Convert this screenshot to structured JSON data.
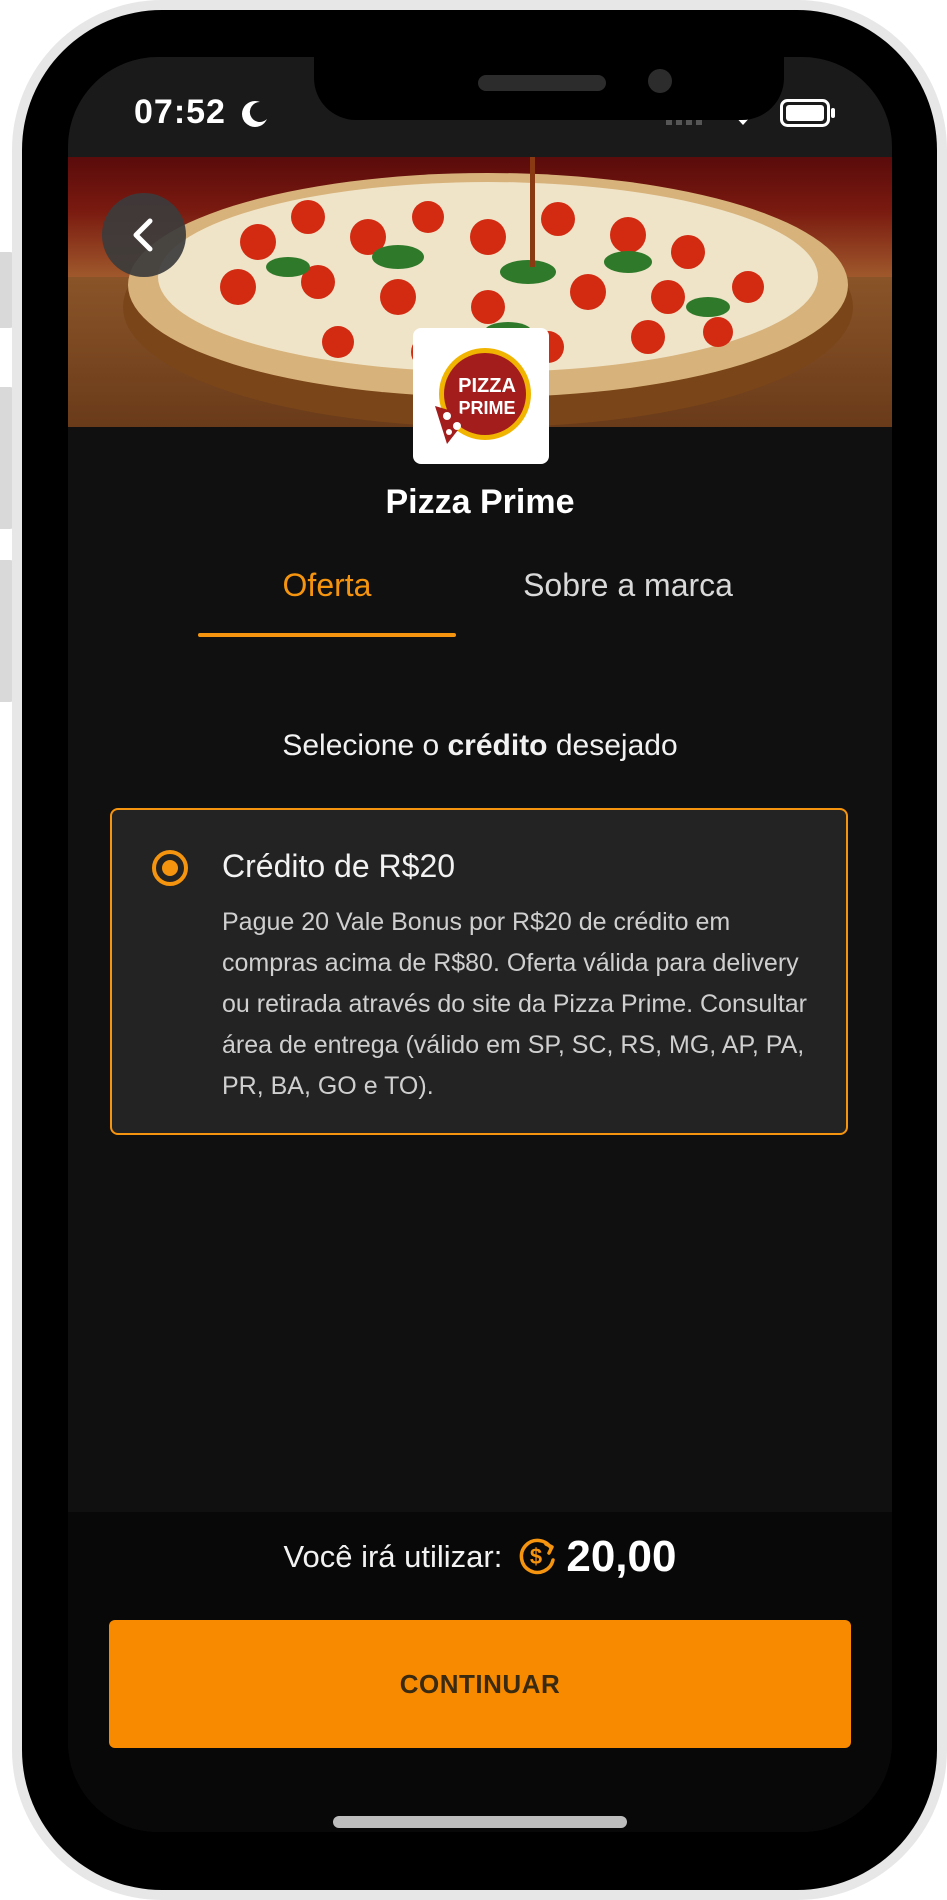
{
  "status_bar": {
    "time": "07:52"
  },
  "brand": {
    "name": "Pizza Prime",
    "logo_text": [
      "PIZZA",
      "PRIME"
    ]
  },
  "tabs": [
    {
      "label": "Oferta",
      "active": true
    },
    {
      "label": "Sobre a marca",
      "active": false
    }
  ],
  "offer": {
    "select_prefix": "Selecione o ",
    "select_bold": "crédito",
    "select_suffix": " desejado",
    "option": {
      "title": "Crédito de R$20",
      "description": "Pague 20 Vale Bonus por R$20 de crédito em compras acima de R$80. Oferta válida para delivery ou retirada através do site da Pizza Prime. Consultar área de entrega (válido em SP, SC, RS, MG, AP, PA, PR, BA, GO e TO).",
      "selected": true
    }
  },
  "footer": {
    "use_label": "Você irá utilizar:",
    "use_value": "20,00",
    "continue_label": "CONTINUAR"
  },
  "colors": {
    "accent": "#f5940e",
    "button": "#f88a00",
    "background": "#101010"
  },
  "icons": [
    "back-arrow-icon",
    "coin-icon",
    "wifi-icon",
    "battery-icon",
    "signal-icon",
    "moon-icon"
  ]
}
